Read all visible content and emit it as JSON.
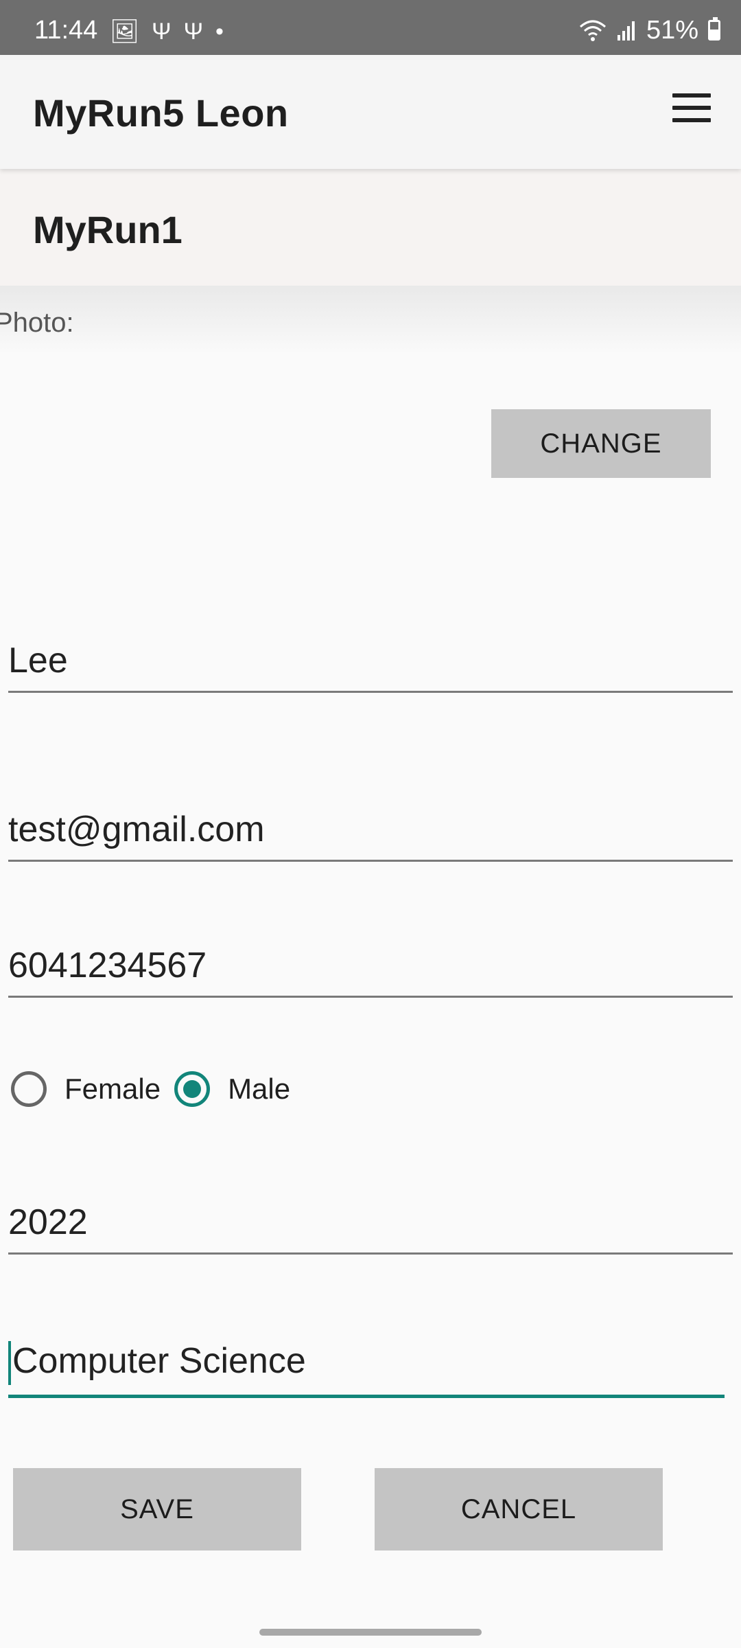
{
  "status_bar": {
    "time": "11:44",
    "left_icons": [
      "image-icon",
      "usb-icon",
      "usb-icon",
      "dot-icon"
    ],
    "right_icons": [
      "wifi-icon",
      "signal-icon",
      "battery-icon"
    ],
    "battery_percent": "51%"
  },
  "app_bar": {
    "title": "MyRun5 Leon",
    "menu_icon": "hamburger-menu-icon"
  },
  "section": {
    "title": "MyRun1"
  },
  "profile": {
    "photo_label": "Photo:",
    "change_button": "CHANGE",
    "name": "Lee",
    "email": "test@gmail.com",
    "phone": "6041234567",
    "gender_options": [
      {
        "label": "Female",
        "checked": false
      },
      {
        "label": "Male",
        "checked": true
      }
    ],
    "class_year": "2022",
    "major": "Computer Science"
  },
  "actions": {
    "save": "SAVE",
    "cancel": "CANCEL"
  },
  "colors": {
    "accent": "#12857a",
    "button_bg": "#c4c4c4",
    "status_bar_bg": "#6e6e6e"
  }
}
